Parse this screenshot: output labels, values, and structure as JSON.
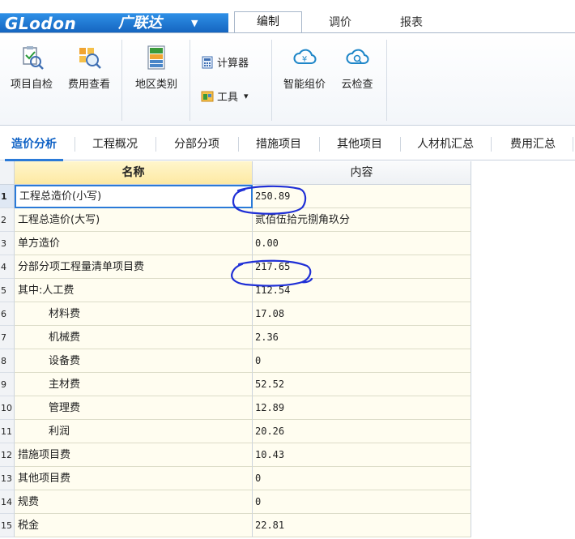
{
  "app": {
    "logo": "GLodon",
    "logo_cn": "广联达",
    "logo_caret": "▼"
  },
  "menu_tabs": [
    {
      "label": "编制",
      "active": true
    },
    {
      "label": "调价",
      "active": false
    },
    {
      "label": "报表",
      "active": false
    }
  ],
  "ribbon": {
    "project_check": "项目自检",
    "fee_view": "费用查看",
    "region_type": "地区类别",
    "calculator": "计算器",
    "tools": "工具",
    "tools_caret": "▾",
    "smart_price": "智能组价",
    "cloud_check": "云检查"
  },
  "sub_tabs": [
    {
      "label": "造价分析",
      "active": true
    },
    {
      "label": "工程概况",
      "active": false
    },
    {
      "label": "分部分项",
      "active": false
    },
    {
      "label": "措施项目",
      "active": false
    },
    {
      "label": "其他项目",
      "active": false
    },
    {
      "label": "人材机汇总",
      "active": false
    },
    {
      "label": "费用汇总",
      "active": false
    }
  ],
  "grid": {
    "col_name": "名称",
    "col_content": "内容",
    "rows": [
      {
        "num": "1",
        "name": "工程总造价(小写)",
        "value": "250.89"
      },
      {
        "num": "2",
        "name": "工程总造价(大写)",
        "value": "贰佰伍拾元捌角玖分"
      },
      {
        "num": "3",
        "name": "单方造价",
        "value": "0.00"
      },
      {
        "num": "4",
        "name": "分部分项工程量清单项目费",
        "value": "217.65"
      },
      {
        "num": "5",
        "name": "其中:人工费",
        "value": "112.54"
      },
      {
        "num": "6",
        "name": "材料费",
        "value": "17.08"
      },
      {
        "num": "7",
        "name": "机械费",
        "value": "2.36"
      },
      {
        "num": "8",
        "name": "设备费",
        "value": "0"
      },
      {
        "num": "9",
        "name": "主材费",
        "value": "52.52"
      },
      {
        "num": "10",
        "name": "管理费",
        "value": "12.89"
      },
      {
        "num": "11",
        "name": "利润",
        "value": "20.26"
      },
      {
        "num": "12",
        "name": "措施项目费",
        "value": "10.43"
      },
      {
        "num": "13",
        "name": "其他项目费",
        "value": "0"
      },
      {
        "num": "14",
        "name": "规费",
        "value": "0"
      },
      {
        "num": "15",
        "name": "税金",
        "value": "22.81"
      }
    ]
  },
  "colors": {
    "accent": "#2a7ad8",
    "annotation": "#1f2fd6",
    "cell_bg": "#fffdf0",
    "header_selected": "#fde9a3"
  }
}
